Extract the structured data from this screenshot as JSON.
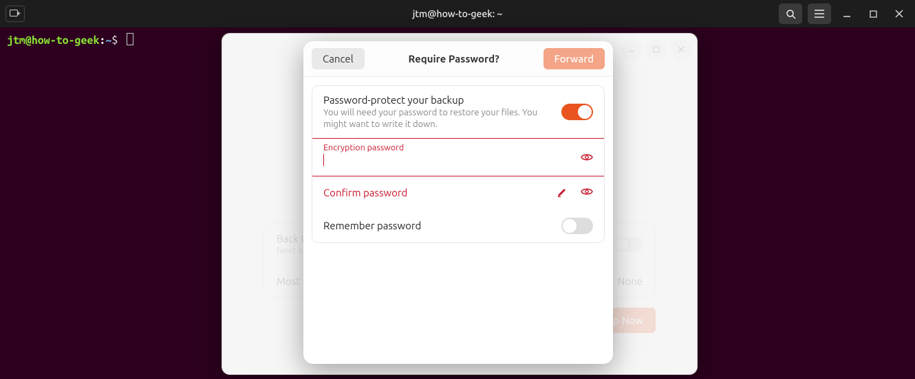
{
  "topbar": {
    "title": "jtm@how-to-geek: ~"
  },
  "terminal": {
    "prompt_user": "jtm@how-to-geek",
    "prompt_tilde": "~",
    "prompt_dollar": "$"
  },
  "bg_window": {
    "row1_title": "Back Up",
    "row1_sub": "Next bac",
    "row2_title": "Most R",
    "row2_value": "None",
    "action_partial": "p Now"
  },
  "dialog": {
    "cancel": "Cancel",
    "title": "Require Password?",
    "forward": "Forward",
    "protect_title": "Password-protect your backup",
    "protect_sub": "You will need your password to restore your files. You might want to write it down.",
    "enc_label": "Encryption password",
    "confirm_label": "Confirm password",
    "remember_label": "Remember password"
  }
}
